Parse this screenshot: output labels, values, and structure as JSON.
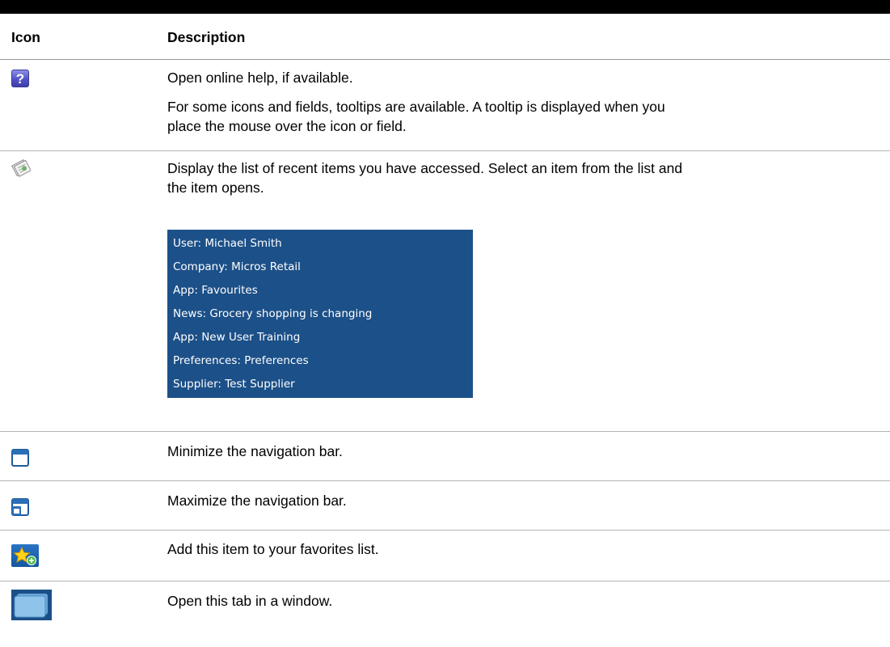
{
  "table": {
    "headers": {
      "icon": "Icon",
      "description": "Description"
    },
    "rows": [
      {
        "icon": "help-icon",
        "glyph": "?",
        "paragraphs": [
          "Open online help, if available.",
          "For some icons and fields, tooltips are available. A tooltip is displayed when you",
          "place the mouse over the icon or field."
        ]
      },
      {
        "icon": "recent-items-icon",
        "paragraphs": [
          "Display the list of recent items you have accessed. Select an item from the list and",
          "the item opens."
        ],
        "recent_items": [
          "User: Michael Smith",
          "Company: Micros Retail",
          "App: Favourites",
          "News: Grocery shopping is changing",
          "App: New User Training",
          "Preferences: Preferences",
          "Supplier: Test Supplier"
        ]
      },
      {
        "icon": "minimize-icon",
        "paragraphs": [
          "Minimize the navigation bar."
        ]
      },
      {
        "icon": "maximize-icon",
        "paragraphs": [
          "Maximize the navigation bar."
        ]
      },
      {
        "icon": "add-favorite-icon",
        "paragraphs": [
          "Add this item to your favorites list."
        ]
      },
      {
        "icon": "open-in-window-icon",
        "paragraphs": [
          "Open this tab in a window."
        ]
      }
    ]
  },
  "colors": {
    "recent_list_background": "#1c5088",
    "icon_blue": "#1b4f88"
  }
}
